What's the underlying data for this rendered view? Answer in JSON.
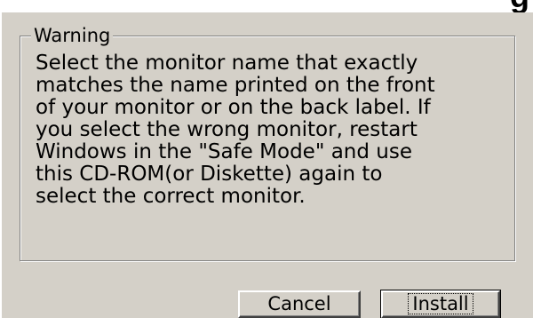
{
  "header": {
    "title_fragment": "g"
  },
  "warning": {
    "title": "Warning",
    "lines": [
      "Select the monitor name that exactly",
      "matches the name printed on the front",
      "of your monitor or on the back label. If",
      "you select the wrong monitor, restart",
      "Windows in the \"Safe Mode\" and use",
      "this CD-ROM(or Diskette) again to",
      "select the correct monitor."
    ]
  },
  "buttons": {
    "cancel_label": "Cancel",
    "install_label": "Install"
  },
  "colors": {
    "dialog_face": "#d4d0c8",
    "highlight": "#ffffff",
    "shadow": "#808080",
    "dark_shadow": "#404040"
  }
}
